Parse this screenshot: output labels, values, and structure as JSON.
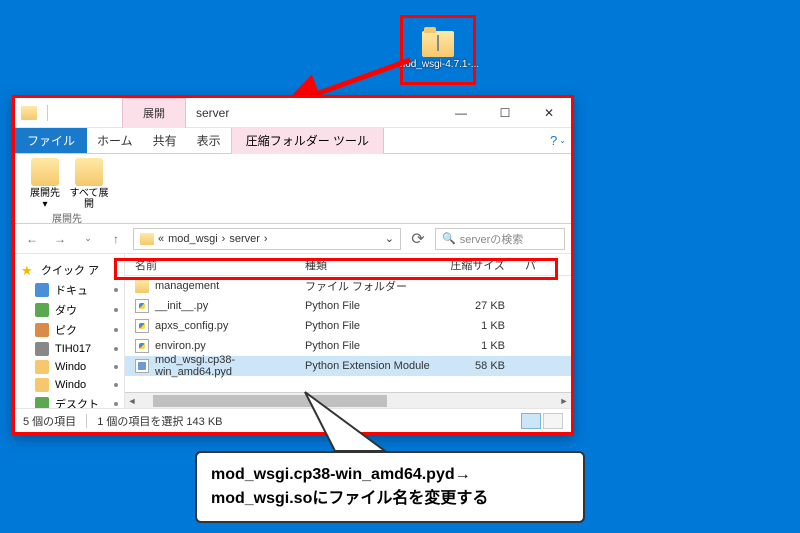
{
  "desktop": {
    "folder_label": "mod_wsgi-4.7.1-..."
  },
  "titlebar": {
    "contextual_group": "展開",
    "title": "server",
    "minimize": "—",
    "maximize": "☐",
    "close": "✕"
  },
  "tabs": {
    "file": "ファイル",
    "home": "ホーム",
    "share": "共有",
    "view": "表示",
    "contextual": "圧縮フォルダー ツール"
  },
  "ribbon": {
    "extract_to": "展開先",
    "extract_to_arrow": "▾",
    "extract_all": "すべて展開",
    "group_label": "展開先"
  },
  "address": {
    "prefix": "«",
    "seg1": "mod_wsgi",
    "sep": "›",
    "seg2": "server",
    "sep2": "›",
    "dropdown": "⌄",
    "refresh": "⟳",
    "search_placeholder": "serverの検索",
    "search_icon": "🔍"
  },
  "nav": {
    "back": "←",
    "forward": "→",
    "up": "↑"
  },
  "sidebar": {
    "quick_access": "クイック ア",
    "items": [
      {
        "label": "ドキュ"
      },
      {
        "label": "ダウ"
      },
      {
        "label": "ピク"
      },
      {
        "label": "TIH017"
      },
      {
        "label": "Windo"
      },
      {
        "label": "Windo"
      },
      {
        "label": "デスクト"
      }
    ]
  },
  "columns": {
    "name": "名前",
    "type": "種類",
    "size": "圧縮サイズ",
    "extra": "パ"
  },
  "files": [
    {
      "name": "management",
      "type": "ファイル フォルダー",
      "size": "",
      "icon": "folder"
    },
    {
      "name": "__init__.py",
      "type": "Python File",
      "size": "27 KB",
      "icon": "py"
    },
    {
      "name": "apxs_config.py",
      "type": "Python File",
      "size": "1 KB",
      "icon": "py"
    },
    {
      "name": "environ.py",
      "type": "Python File",
      "size": "1 KB",
      "icon": "py"
    },
    {
      "name": "mod_wsgi.cp38-win_amd64.pyd",
      "type": "Python Extension Module",
      "size": "58 KB",
      "icon": "pyd",
      "selected": true
    }
  ],
  "status": {
    "count": "5 個の項目",
    "selection": "1 個の項目を選択 143 KB"
  },
  "callout": {
    "line1": "mod_wsgi.cp38-win_amd64.pyd→",
    "line2": "mod_wsgi.soにファイル名を変更する"
  },
  "help": "?"
}
